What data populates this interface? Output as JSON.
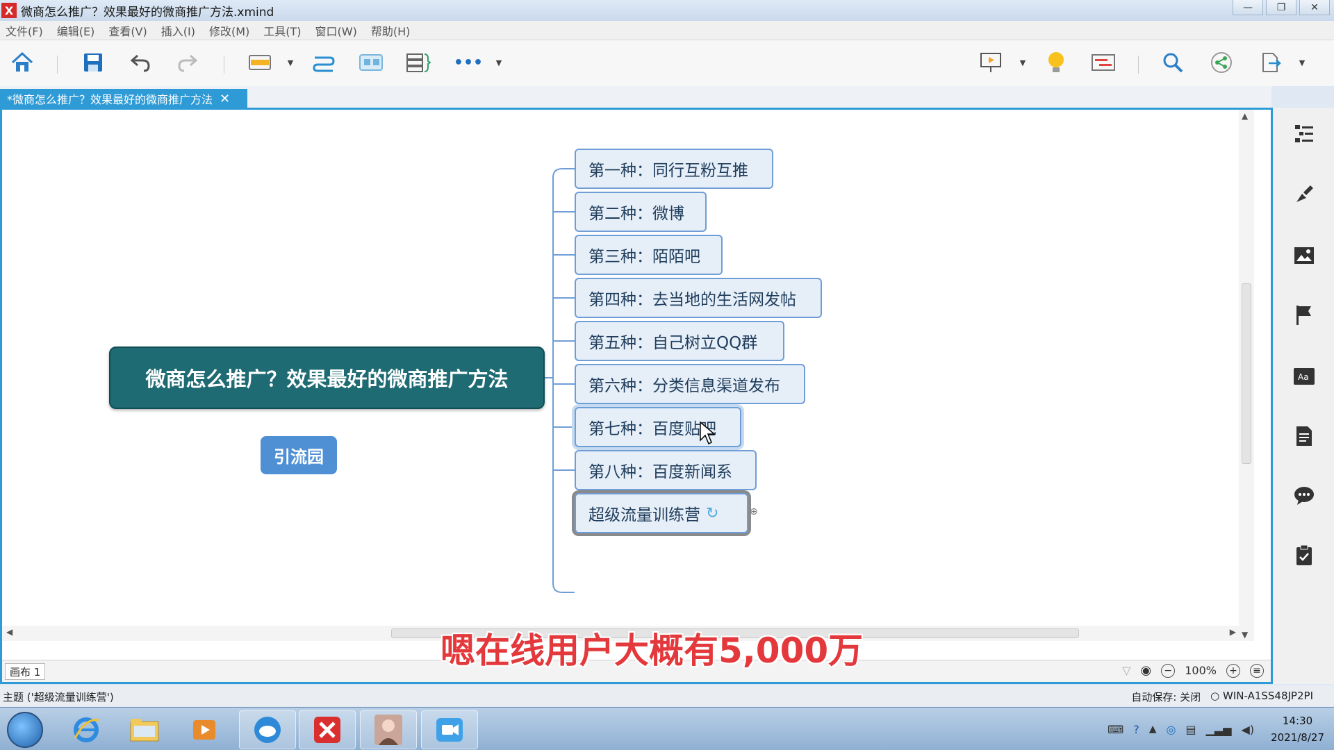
{
  "window": {
    "title": "微商怎么推广？效果最好的微商推广方法.xmind",
    "app_logo": "X"
  },
  "menu": [
    "文件(F)",
    "编辑(E)",
    "查看(V)",
    "插入(I)",
    "修改(M)",
    "工具(T)",
    "窗口(W)",
    "帮助(H)"
  ],
  "tab": {
    "label": "*微商怎么推广？效果最好的微商推广方法"
  },
  "mindmap": {
    "central": "微商怎么推广？效果最好的微商推广方法",
    "floating": "引流园",
    "topics": [
      "第一种：同行互粉互推",
      "第二种：微博",
      "第三种：陌陌吧",
      "第四种：去当地的生活网发帖",
      "第五种：自己树立QQ群",
      "第六种：分类信息渠道发布",
      "第七种：百度贴吧",
      "第八种：百度新闻系",
      "超级流量训练营"
    ]
  },
  "subtitle": "嗯在线用户大概有5,000万",
  "canvas_bar": {
    "sheet": "画布 1",
    "zoom": "100%"
  },
  "status": {
    "left": "主题 ('超级流量训练营')",
    "autosave": "自动保存: 关闭",
    "host": "WIN-A1SS48JP2PI"
  },
  "clock": {
    "time": "14:30",
    "date": "2021/8/27"
  },
  "colors": {
    "accent": "#2f9bd6",
    "central_fill": "#1e6b73",
    "topic_border": "#6f9ed6",
    "subtitle": "#e4393c"
  }
}
